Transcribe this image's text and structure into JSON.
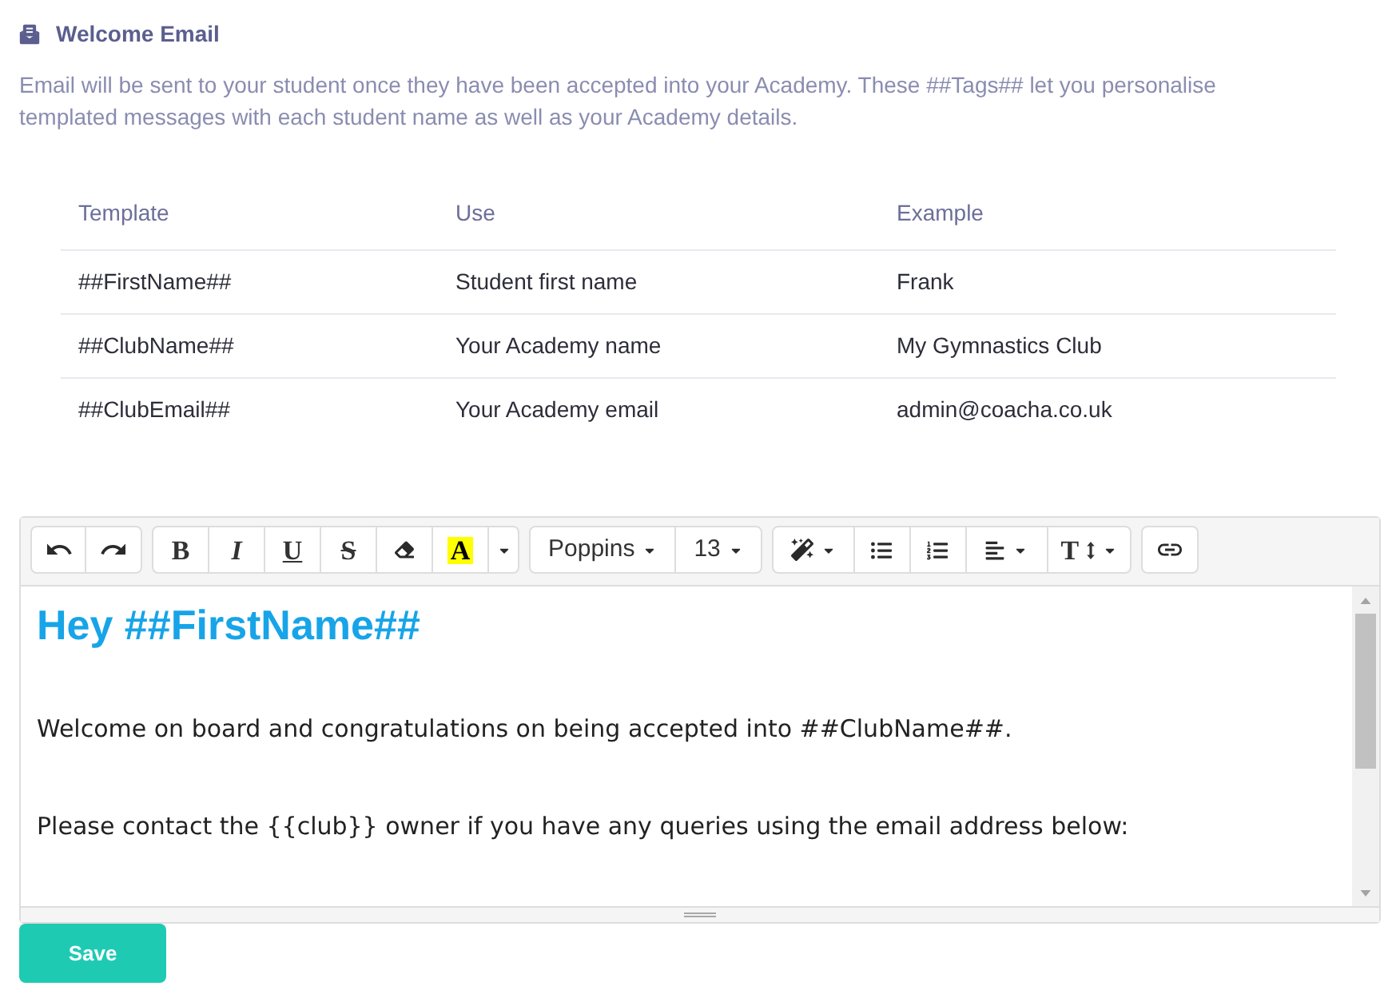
{
  "section": {
    "title": "Welcome Email",
    "description": "Email will be sent to your student once they have been accepted into your Academy. These ##Tags## let you personalise templated messages with each student name as well as your Academy details."
  },
  "table": {
    "columns": [
      "Template",
      "Use",
      "Example"
    ],
    "rows": [
      [
        "##FirstName##",
        "Student first name",
        "Frank"
      ],
      [
        "##ClubName##",
        "Your Academy name",
        "My Gymnastics Club"
      ],
      [
        "##ClubEmail##",
        "Your Academy email",
        "admin@coacha.co.uk"
      ]
    ]
  },
  "editor": {
    "toolbar_groups": [
      {
        "buttons": [
          {
            "kind": "undo",
            "dropdown": false
          },
          {
            "kind": "redo",
            "dropdown": false
          }
        ]
      },
      {
        "buttons": [
          {
            "kind": "bold",
            "label": "B",
            "dropdown": false
          },
          {
            "kind": "italic",
            "label": "I",
            "dropdown": false
          },
          {
            "kind": "underline",
            "label": "U",
            "dropdown": false
          },
          {
            "kind": "strikethrough",
            "label": "S",
            "dropdown": false
          },
          {
            "kind": "eraser",
            "dropdown": false
          },
          {
            "kind": "highlight",
            "label": "A",
            "dropdown": false
          },
          {
            "kind": "caret",
            "dropdown": true
          }
        ]
      },
      {
        "buttons": [
          {
            "kind": "select",
            "label": "Poppins",
            "dropdown": true
          },
          {
            "kind": "select",
            "label": "13",
            "dropdown": true
          }
        ]
      },
      {
        "buttons": [
          {
            "kind": "magic",
            "dropdown": true
          },
          {
            "kind": "bullet-list",
            "dropdown": false
          },
          {
            "kind": "numbered-list",
            "dropdown": false
          },
          {
            "kind": "align",
            "dropdown": true
          },
          {
            "kind": "line-height",
            "label": "T",
            "dropdown": true
          }
        ]
      },
      {
        "buttons": [
          {
            "kind": "link",
            "dropdown": false
          }
        ]
      }
    ],
    "content": [
      {
        "kind": "heading",
        "text": "Hey ##FirstName##"
      },
      {
        "kind": "paragraph",
        "text": "Welcome on board and congratulations on being accepted into ##ClubName##."
      },
      {
        "kind": "paragraph",
        "text": "Please contact the {{club}} owner if you have any queries using the email address below:"
      }
    ]
  },
  "save_button": {
    "label": "Save"
  }
}
